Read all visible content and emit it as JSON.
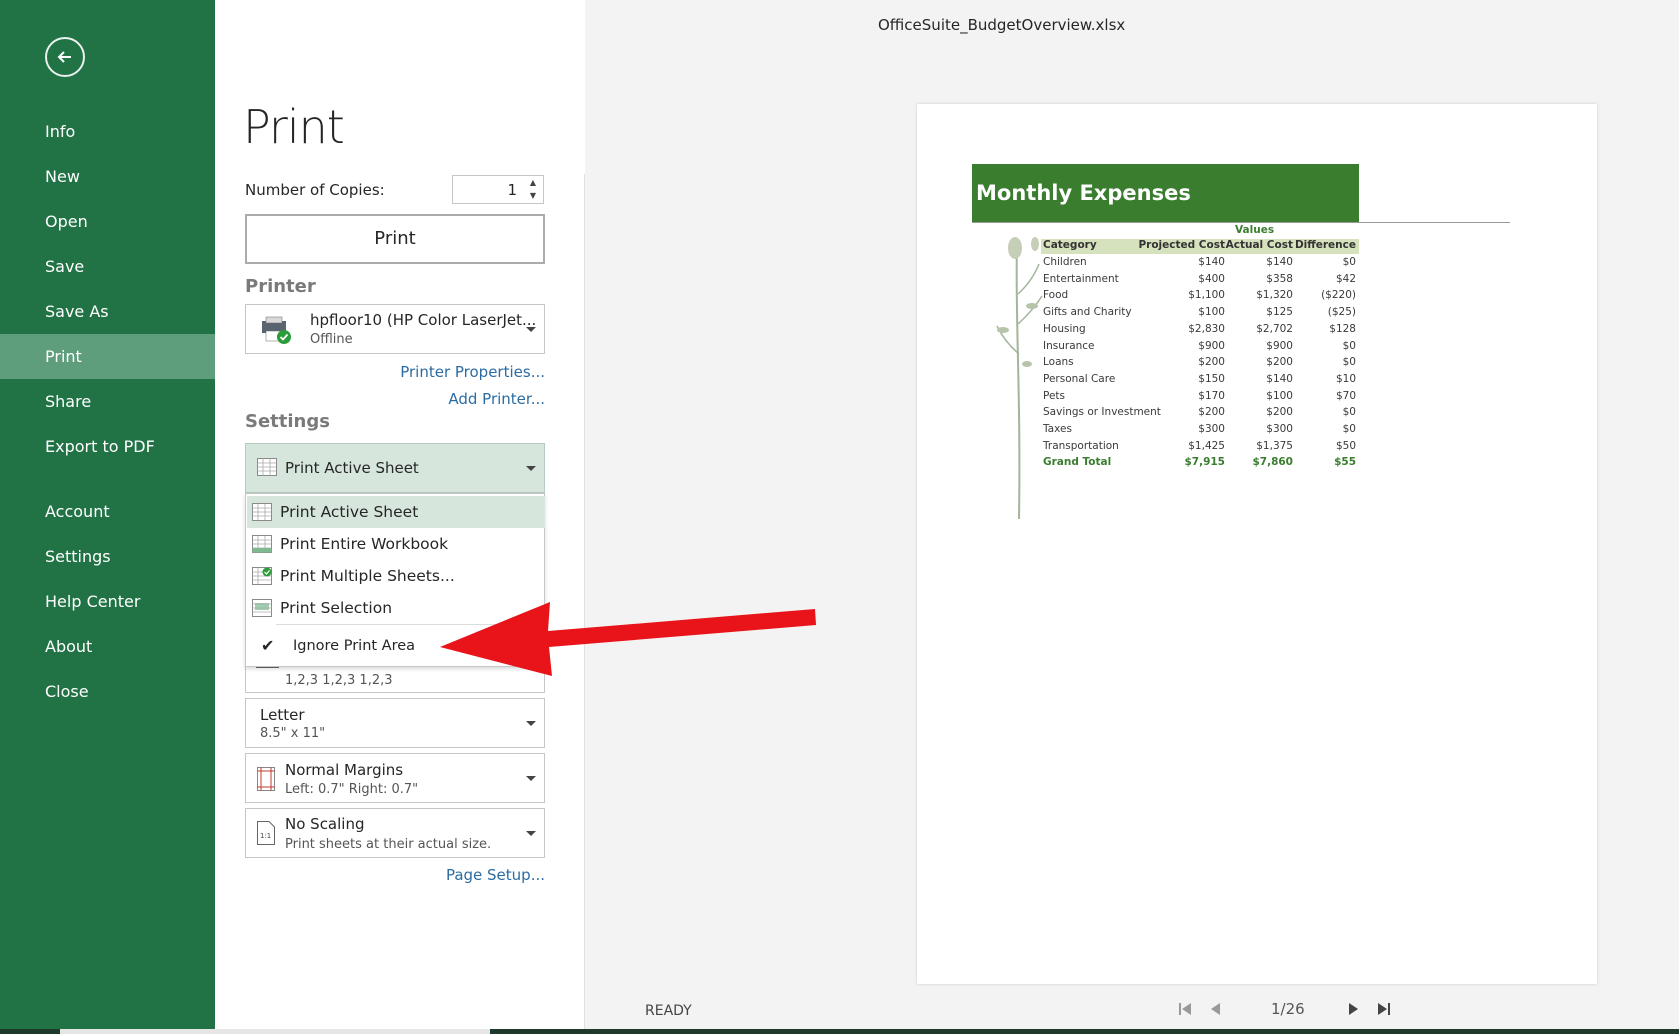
{
  "window": {
    "title": "OfficeSuite_BudgetOverview.xlsx"
  },
  "sidebar": {
    "items": [
      {
        "label": "Info"
      },
      {
        "label": "New"
      },
      {
        "label": "Open"
      },
      {
        "label": "Save"
      },
      {
        "label": "Save As"
      },
      {
        "label": "Print"
      },
      {
        "label": "Share"
      },
      {
        "label": "Export to PDF"
      },
      {
        "label": "Account"
      },
      {
        "label": "Settings"
      },
      {
        "label": "Help Center"
      },
      {
        "label": "About"
      },
      {
        "label": "Close"
      }
    ],
    "active": "Print"
  },
  "print": {
    "heading": "Print",
    "copies_label": "Number of Copies:",
    "copies_value": "1",
    "print_button": "Print"
  },
  "printer": {
    "section": "Printer",
    "name": "hpfloor10 (HP Color LaserJet...",
    "status": "Offline",
    "properties_link": "Printer Properties...",
    "add_link": "Add Printer..."
  },
  "settings": {
    "section": "Settings",
    "selected": "Print Active Sheet",
    "menu": [
      {
        "label": "Print Active Sheet"
      },
      {
        "label": "Print Entire Workbook"
      },
      {
        "label": "Print Multiple Sheets..."
      },
      {
        "label": "Print Selection"
      }
    ],
    "ignore_print_area": "Ignore Print Area",
    "collate_sub": "1,2,3   1,2,3   1,2,3",
    "paper": {
      "main": "Letter",
      "sub": "8.5\" x 11\""
    },
    "margins": {
      "main": "Normal Margins",
      "sub": "Left: 0.7\"   Right: 0.7\""
    },
    "scaling": {
      "main": "No Scaling",
      "sub": "Print sheets at their actual size."
    },
    "page_setup_link": "Page Setup..."
  },
  "preview": {
    "title": "Monthly Expenses",
    "values_label": "Values",
    "columns": [
      "Category",
      "Projected Cost",
      "Actual Cost",
      "Difference"
    ],
    "rows": [
      [
        "Children",
        "$140",
        "$140",
        "$0"
      ],
      [
        "Entertainment",
        "$400",
        "$358",
        "$42"
      ],
      [
        "Food",
        "$1,100",
        "$1,320",
        "($220)"
      ],
      [
        "Gifts and Charity",
        "$100",
        "$125",
        "($25)"
      ],
      [
        "Housing",
        "$2,830",
        "$2,702",
        "$128"
      ],
      [
        "Insurance",
        "$900",
        "$900",
        "$0"
      ],
      [
        "Loans",
        "$200",
        "$200",
        "$0"
      ],
      [
        "Personal Care",
        "$150",
        "$140",
        "$10"
      ],
      [
        "Pets",
        "$170",
        "$100",
        "$70"
      ],
      [
        "Savings or Investment",
        "$200",
        "$200",
        "$0"
      ],
      [
        "Taxes",
        "$300",
        "$300",
        "$0"
      ],
      [
        "Transportation",
        "$1,425",
        "$1,375",
        "$50"
      ]
    ],
    "total": [
      "Grand Total",
      "$7,915",
      "$7,860",
      "$55"
    ]
  },
  "status": {
    "ready": "READY",
    "page": "1/26"
  },
  "colors": {
    "sidebar": "#217346",
    "sidebar_active": "#5e9e7c",
    "accent_green": "#3a7d2e",
    "link": "#2b6ca3",
    "arrow": "#e8141a"
  },
  "icons": [
    "back-arrow-icon",
    "printer-icon",
    "sheet-icon",
    "workbook-icon",
    "multiple-sheets-icon",
    "selection-icon",
    "check-icon",
    "collate-icon",
    "margins-icon",
    "scaling-icon",
    "first-page-icon",
    "prev-page-icon",
    "next-page-icon",
    "last-page-icon"
  ]
}
